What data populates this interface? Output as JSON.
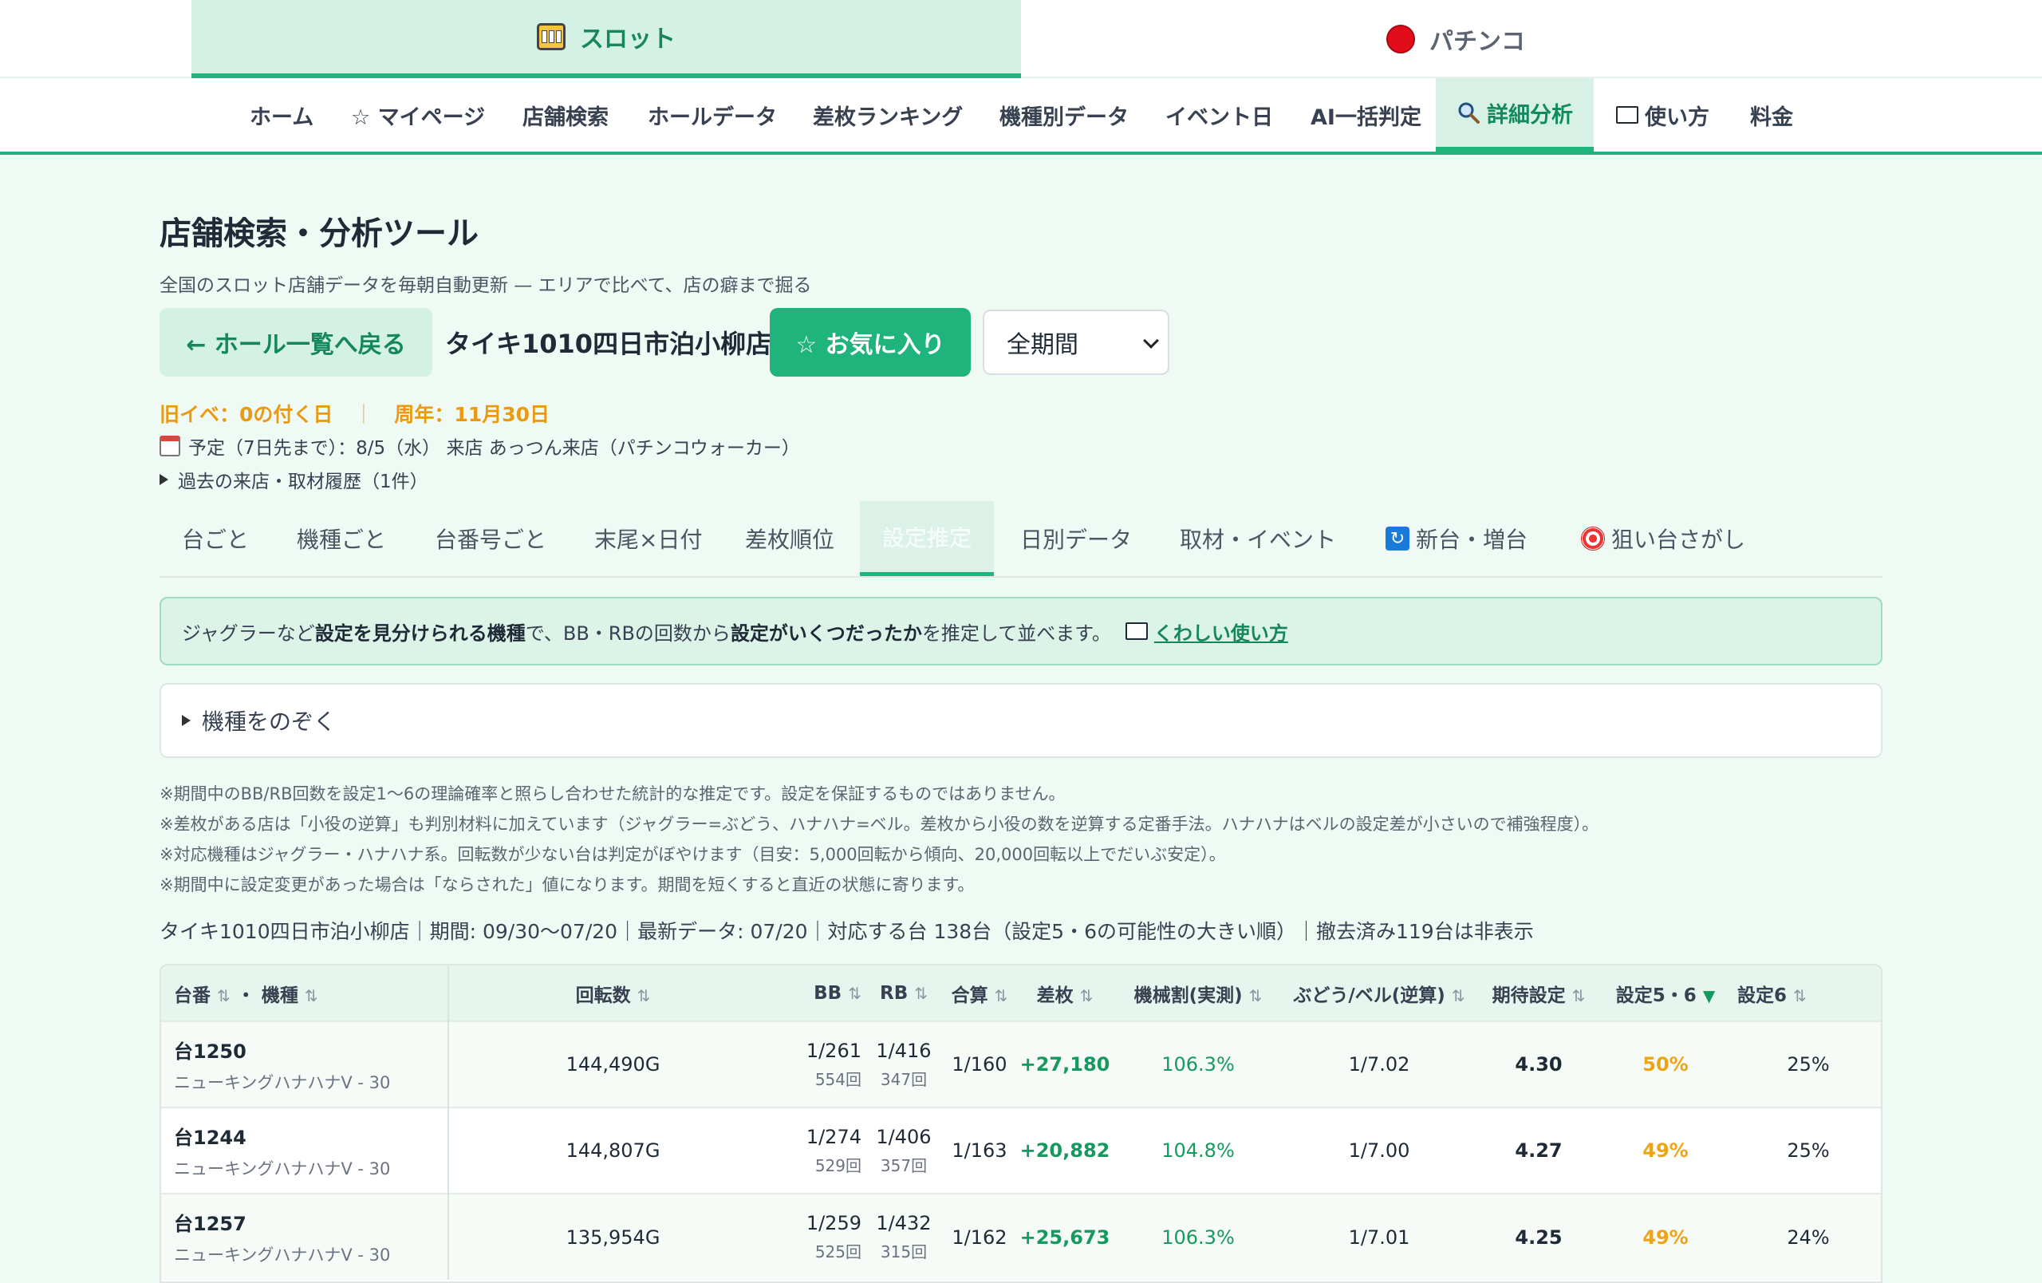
{
  "mode_tabs": {
    "slot": "スロット",
    "pachinko": "パチンコ"
  },
  "nav": {
    "home": "ホーム",
    "mypage": "☆ マイページ",
    "store_search": "店舗検索",
    "hall_data": "ホールデータ",
    "ranking": "差枚ランキング",
    "model_data": "機種別データ",
    "event_day": "イベント日",
    "ai_judge": "AI一括判定",
    "detail": "詳細分析",
    "howto": "使い方",
    "price": "料金"
  },
  "page": {
    "title": "店舗検索・分析ツール",
    "subtitle": "全国のスロット店舗データを毎朝自動更新 — エリアで比べて、店の癖まで掘る"
  },
  "actions": {
    "back": "← ホール一覧へ戻る",
    "hall_name": "タイキ1010四日市泊小柳店",
    "favorite": "☆ お気に入り",
    "period": "全期間"
  },
  "events": {
    "old_event": "旧イベ：0の付く日",
    "separator": "｜",
    "anniversary": "周年：11月30日",
    "schedule": "予定（7日先まで）：8/5（水） 来店 あっつん来店（パチンコウォーカー）",
    "history": "過去の来店・取材履歴（1件）"
  },
  "subtabs": {
    "per_unit": "台ごと",
    "per_model": "機種ごと",
    "per_number": "台番号ごと",
    "tail_date": "末尾×日付",
    "diff_rank": "差枚順位",
    "setting_est": "設定推定",
    "daily": "日別データ",
    "coverage": "取材・イベント",
    "new_units": "新台・増台",
    "target": "狙い台さがし"
  },
  "info": {
    "t1": "ジャグラーなど",
    "b1": "設定を見分けられる機種",
    "t2": "で、BB・RBの回数から",
    "b2": "設定がいくつだったか",
    "t3": "を推定して並べます。",
    "link": "くわしい使い方"
  },
  "exclude": {
    "label": "機種をのぞく"
  },
  "notes": [
    "※期間中のBB/RB回数を設定1〜6の理論確率と照らし合わせた統計的な推定です。設定を保証するものではありません。",
    "※差枚がある店は「小役の逆算」も判別材料に加えています（ジャグラー=ぶどう、ハナハナ=ベル。差枚から小役の数を逆算する定番手法。ハナハナはベルの設定差が小さいので補強程度）。",
    "※対応機種はジャグラー・ハナハナ系。回転数が少ない台は判定がぼやけます（目安：5,000回転から傾向、20,000回転以上でだいぶ安定）。",
    "※期間中に設定変更があった場合は「ならされた」値になります。期間を短くすると直近の状態に寄ります。"
  ],
  "summary": "タイキ1010四日市泊小柳店｜期間: 09/30〜07/20｜最新データ: 07/20｜対応する台 138台（設定5・6の可能性の大きい順）｜撤去済み119台は非表示",
  "table": {
    "headers": {
      "unit": "台番",
      "dot": "・",
      "model": "機種",
      "spins": "回転数",
      "bb": "BB",
      "rb": "RB",
      "total": "合算",
      "diff": "差枚",
      "payout": "機械割(実測)",
      "grape": "ぶどう/ベル(逆算)",
      "expected": "期待設定",
      "p56": "設定5・6",
      "p6": "設定6"
    },
    "rows": [
      {
        "unit": "台1250",
        "model": "ニューキングハナハナV - 30",
        "spins": "144,490G",
        "bb": "1/261",
        "bb_count": "554回",
        "rb": "1/416",
        "rb_count": "347回",
        "total": "1/160",
        "diff": "+27,180",
        "payout": "106.3%",
        "grape": "1/7.02",
        "expected": "4.30",
        "p56": "50%",
        "p6": "25%"
      },
      {
        "unit": "台1244",
        "model": "ニューキングハナハナV - 30",
        "spins": "144,807G",
        "bb": "1/274",
        "bb_count": "529回",
        "rb": "1/406",
        "rb_count": "357回",
        "total": "1/163",
        "diff": "+20,882",
        "payout": "104.8%",
        "grape": "1/7.00",
        "expected": "4.27",
        "p56": "49%",
        "p6": "25%"
      },
      {
        "unit": "台1257",
        "model": "ニューキングハナハナV - 30",
        "spins": "135,954G",
        "bb": "1/259",
        "bb_count": "525回",
        "rb": "1/432",
        "rb_count": "315回",
        "total": "1/162",
        "diff": "+25,673",
        "payout": "106.3%",
        "grape": "1/7.01",
        "expected": "4.25",
        "p56": "49%",
        "p6": "24%"
      }
    ]
  }
}
